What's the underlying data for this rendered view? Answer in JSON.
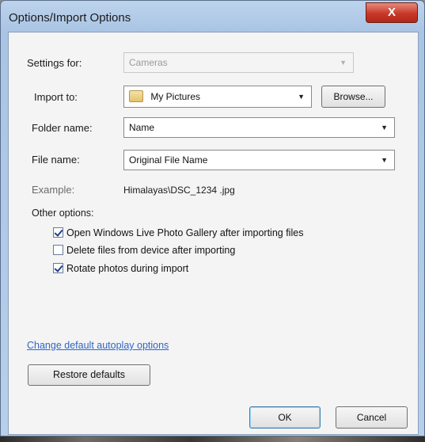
{
  "window": {
    "title": "Options/Import Options",
    "close_label": "X"
  },
  "settings_for": {
    "label": "Settings for:",
    "value": "Cameras"
  },
  "import_to": {
    "label": "Import to:",
    "value": "My Pictures",
    "browse_label": "Browse..."
  },
  "folder_name": {
    "label": "Folder name:",
    "value": "Name"
  },
  "file_name": {
    "label": "File name:",
    "value": "Original File Name"
  },
  "example": {
    "label": "Example:",
    "value": "Himalayas\\DSC_1234 .jpg"
  },
  "other_options": {
    "label": "Other options:",
    "items": [
      {
        "label": "Open Windows Live Photo Gallery after importing files",
        "checked": true
      },
      {
        "label": "Delete files from device after importing",
        "checked": false
      },
      {
        "label": "Rotate photos during import",
        "checked": true
      }
    ]
  },
  "autoplay_link": "Change default autoplay options",
  "restore_label": "Restore defaults",
  "ok_label": "OK",
  "cancel_label": "Cancel",
  "icons": {
    "dropdown": "chevron-down-icon",
    "folder": "folder-icon",
    "close": "close-icon",
    "checkbox": "checkbox-icon"
  }
}
